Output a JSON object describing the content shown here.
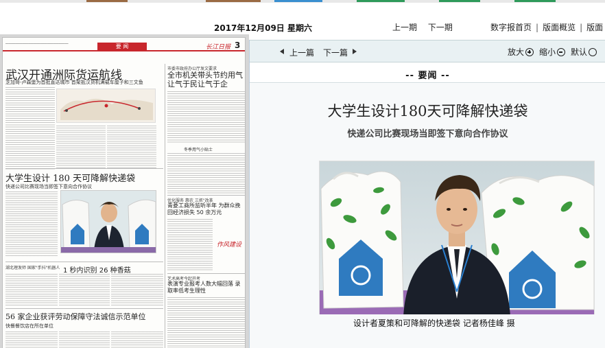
{
  "header": {
    "date": "2017年12月09日 星期六",
    "page_nav": [
      "上一期",
      "下一期"
    ],
    "site_nav": [
      "数字报首页",
      "版面概览",
      "版面"
    ]
  },
  "paper": {
    "section": "要  闻",
    "brand": "长江日报",
    "page_number": "3",
    "headline1": "武汉开通洲际货运航线",
    "headline1_sub": "芝加哥-卢森堡为首批直达城市 首架抵汉货机满载车厘子和三文鱼",
    "right_tag1": "市委市政府办公厅发文要求",
    "right_title1": "全市机关带头节约用气 让气于民让气于企",
    "right_sub1": "冬季用气小贴士",
    "headline2": "大学生设计 180 天可降解快递袋",
    "headline2_sub": "快递公司比赛现场当即签下意向合作协议",
    "right_tag2": "优化服务 惠农 三抓\"改革",
    "right_title2": "青菱工商所监听半年 为群众挽回经济损失 50 余万元",
    "seal": "作风建设",
    "tag3": "湖北理发师 国家\"手抖\"机器人",
    "headline3": "1 秒内识别 26 种香菇",
    "right_tag3": "艺术高考今起开考",
    "right_title3": "表演专业报考人数大幅回落 录取率低考生理性",
    "headline4": "56 家企业获评劳动保障守法诚信示范单位",
    "headline4_sub": "快餐餐饮店在所在单位"
  },
  "viewer": {
    "prev_article": "上一篇",
    "next_article": "下一篇",
    "zoom_in": "放大",
    "zoom_out": "缩小",
    "zoom_default": "默认",
    "section_label": "--  要闻  --",
    "title": "大学生设计180天可降解快递袋",
    "subtitle": "快递公司比赛现场当即签下意向合作协议",
    "caption": "设计者夏策和可降解的快递袋   记者杨佳峰 摄"
  },
  "colors": {
    "accent_red": "#c8262c",
    "toolbar_bg": "#e9f1f3"
  }
}
